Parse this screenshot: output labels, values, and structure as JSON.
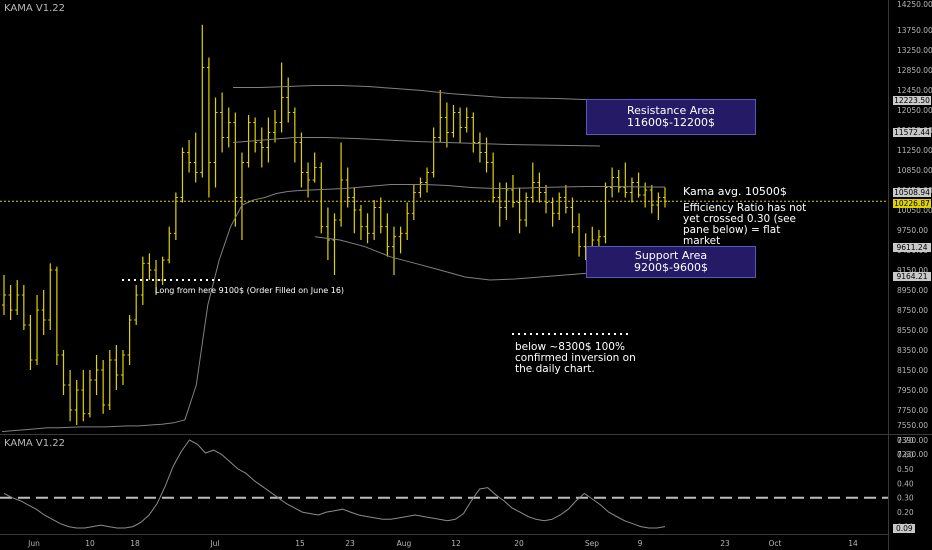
{
  "pane_titles": {
    "main": "KAMA V1.22",
    "lower": "KAMA V1.22"
  },
  "annotations": {
    "long": "Long from here 9100$ (Order Filled on June 16)",
    "kama_avg": "Kama avg. 10500$",
    "efficiency": [
      "Efficiency Ratio has not",
      "yet crossed 0.30 (see",
      "pane below) = flat",
      "market"
    ],
    "below": [
      "below ~8300$ 100%",
      "confirmed inversion on",
      "the daily chart."
    ]
  },
  "boxes": {
    "resistance": [
      "Resistance Area",
      "11600$-12200$"
    ],
    "support": [
      "Support Area",
      "9200$-9600$"
    ]
  },
  "price_labels": {
    "upper_band": "12223.50",
    "upper2": "11572.44",
    "kama": "10508.94",
    "current": "10226.87",
    "lower_band": "9611.24",
    "lower2": "9164.21"
  },
  "colors": {
    "background": "#000000",
    "bars": "#e0d200",
    "kama_line": "#808080",
    "annotation_box": "#241a66",
    "price_label": "#c9c9c9"
  },
  "chart_data": {
    "type": "ohlc",
    "instrument_indicator": "KAMA V1.22",
    "y_axis": {
      "ticks": [
        14250,
        13750,
        13250,
        12850,
        12450,
        12050,
        11650,
        11250,
        10850,
        10450,
        10050,
        9750,
        9450,
        9150,
        8950,
        8750,
        8550,
        8350,
        8150,
        7950,
        7750,
        7550,
        7390,
        7230
      ],
      "labels": [
        "14250.00",
        "13750.00",
        "13250.00",
        "12850.00",
        "12450.00",
        "12050.00",
        "11650.00",
        "11250.00",
        "10850.00",
        "10450.00",
        "10050.00",
        "9750.00",
        "9450.00",
        "9150.00",
        "8950.00",
        "8750.00",
        "8550.00",
        "8350.00",
        "8150.00",
        "7950.00",
        "7750.00",
        "7550.00",
        "7390.00",
        "7230.00"
      ]
    },
    "x_axis": {
      "labels": [
        "Jun",
        "10",
        "18",
        "Jul",
        "15",
        "23",
        "Aug",
        "12",
        "20",
        "Sep",
        "9",
        "23",
        "Oct",
        "14"
      ]
    },
    "lower_pane": {
      "ticks": [
        0.7,
        0.6,
        0.5,
        0.4,
        0.3,
        0.2,
        0.1
      ],
      "labels": [
        "0.70",
        "0.60",
        "0.50",
        "0.40",
        "0.30",
        "0.20",
        "0.10"
      ],
      "current": "0.09",
      "threshold": 0.3
    },
    "series": [
      {
        "name": "price_bars",
        "values": [
          {
            "o": 8800,
            "h": 9100,
            "l": 8700,
            "c": 8900
          },
          {
            "o": 8900,
            "h": 9000,
            "l": 8650,
            "c": 8750
          },
          {
            "o": 8750,
            "h": 9050,
            "l": 8700,
            "c": 8900
          },
          {
            "o": 8900,
            "h": 9000,
            "l": 8550,
            "c": 8600
          },
          {
            "o": 8600,
            "h": 8700,
            "l": 8150,
            "c": 8250
          },
          {
            "o": 8250,
            "h": 8900,
            "l": 8200,
            "c": 8750
          },
          {
            "o": 8750,
            "h": 8950,
            "l": 8500,
            "c": 8650
          },
          {
            "o": 8650,
            "h": 9250,
            "l": 8550,
            "c": 9150
          },
          {
            "o": 9150,
            "h": 9200,
            "l": 8200,
            "c": 8300
          },
          {
            "o": 8300,
            "h": 8350,
            "l": 7900,
            "c": 8000
          },
          {
            "o": 8000,
            "h": 8150,
            "l": 7600,
            "c": 7750
          },
          {
            "o": 7750,
            "h": 8050,
            "l": 7550,
            "c": 7950
          },
          {
            "o": 7950,
            "h": 8150,
            "l": 7600,
            "c": 7700
          },
          {
            "o": 7700,
            "h": 8150,
            "l": 7650,
            "c": 8050
          },
          {
            "o": 8050,
            "h": 8300,
            "l": 7900,
            "c": 8150
          },
          {
            "o": 8150,
            "h": 8250,
            "l": 7700,
            "c": 7800
          },
          {
            "o": 7800,
            "h": 8350,
            "l": 7750,
            "c": 8250
          },
          {
            "o": 8250,
            "h": 8400,
            "l": 7950,
            "c": 8100
          },
          {
            "o": 8100,
            "h": 8350,
            "l": 8000,
            "c": 8300
          },
          {
            "o": 8300,
            "h": 8700,
            "l": 8200,
            "c": 8650
          },
          {
            "o": 8650,
            "h": 9000,
            "l": 8600,
            "c": 8900
          },
          {
            "o": 8900,
            "h": 9350,
            "l": 8800,
            "c": 9250
          },
          {
            "o": 9250,
            "h": 9400,
            "l": 9050,
            "c": 9150
          },
          {
            "o": 9150,
            "h": 9300,
            "l": 8900,
            "c": 9050
          },
          {
            "o": 9050,
            "h": 9350,
            "l": 9000,
            "c": 9300
          },
          {
            "o": 9300,
            "h": 9800,
            "l": 9250,
            "c": 9700
          },
          {
            "o": 9700,
            "h": 10400,
            "l": 9600,
            "c": 10300
          },
          {
            "o": 10300,
            "h": 11300,
            "l": 10200,
            "c": 11200
          },
          {
            "o": 11200,
            "h": 11450,
            "l": 10800,
            "c": 11000
          },
          {
            "o": 11000,
            "h": 11600,
            "l": 10600,
            "c": 10800
          },
          {
            "o": 10800,
            "h": 13850,
            "l": 10700,
            "c": 12900
          },
          {
            "o": 12900,
            "h": 13100,
            "l": 10300,
            "c": 11000
          },
          {
            "o": 11000,
            "h": 12300,
            "l": 10500,
            "c": 12000
          },
          {
            "o": 12000,
            "h": 12400,
            "l": 11200,
            "c": 11500
          },
          {
            "o": 11500,
            "h": 12100,
            "l": 11300,
            "c": 11800
          },
          {
            "o": 11800,
            "h": 12000,
            "l": 9800,
            "c": 10300
          },
          {
            "o": 10300,
            "h": 11200,
            "l": 9600,
            "c": 11000
          },
          {
            "o": 11000,
            "h": 11950,
            "l": 10900,
            "c": 11800
          },
          {
            "o": 11800,
            "h": 11900,
            "l": 11200,
            "c": 11400
          },
          {
            "o": 11400,
            "h": 11700,
            "l": 10900,
            "c": 11300
          },
          {
            "o": 11300,
            "h": 11900,
            "l": 11000,
            "c": 11600
          },
          {
            "o": 11600,
            "h": 12050,
            "l": 11400,
            "c": 11800
          },
          {
            "o": 11800,
            "h": 13000,
            "l": 11600,
            "c": 12300
          },
          {
            "o": 12300,
            "h": 12700,
            "l": 11800,
            "c": 12000
          },
          {
            "o": 12000,
            "h": 12100,
            "l": 11000,
            "c": 11400
          },
          {
            "o": 11400,
            "h": 11600,
            "l": 10500,
            "c": 10800
          },
          {
            "o": 10800,
            "h": 11000,
            "l": 10300,
            "c": 10650
          },
          {
            "o": 10650,
            "h": 11200,
            "l": 10600,
            "c": 10900
          },
          {
            "o": 10900,
            "h": 11000,
            "l": 9700,
            "c": 9800
          },
          {
            "o": 9800,
            "h": 10100,
            "l": 9300,
            "c": 9600
          },
          {
            "o": 9600,
            "h": 10000,
            "l": 9100,
            "c": 9900
          },
          {
            "o": 9900,
            "h": 11400,
            "l": 9800,
            "c": 10650
          },
          {
            "o": 10650,
            "h": 10900,
            "l": 10100,
            "c": 10300
          },
          {
            "o": 10300,
            "h": 10500,
            "l": 9700,
            "c": 10050
          },
          {
            "o": 10050,
            "h": 10150,
            "l": 9600,
            "c": 9800
          },
          {
            "o": 9800,
            "h": 10000,
            "l": 9550,
            "c": 9700
          },
          {
            "o": 9700,
            "h": 10250,
            "l": 9600,
            "c": 10100
          },
          {
            "o": 10100,
            "h": 10300,
            "l": 9700,
            "c": 9800
          },
          {
            "o": 9800,
            "h": 10000,
            "l": 9350,
            "c": 9500
          },
          {
            "o": 9500,
            "h": 9800,
            "l": 9100,
            "c": 9650
          },
          {
            "o": 9650,
            "h": 9800,
            "l": 9400,
            "c": 9700
          },
          {
            "o": 9700,
            "h": 10200,
            "l": 9600,
            "c": 10000
          },
          {
            "o": 10000,
            "h": 10550,
            "l": 9900,
            "c": 10400
          },
          {
            "o": 10400,
            "h": 10700,
            "l": 10300,
            "c": 10600
          },
          {
            "o": 10600,
            "h": 10900,
            "l": 10400,
            "c": 10800
          },
          {
            "o": 10800,
            "h": 11700,
            "l": 10700,
            "c": 11500
          },
          {
            "o": 11500,
            "h": 12450,
            "l": 11400,
            "c": 11900
          },
          {
            "o": 11900,
            "h": 12200,
            "l": 11300,
            "c": 11600
          },
          {
            "o": 11600,
            "h": 12150,
            "l": 11500,
            "c": 12000
          },
          {
            "o": 12000,
            "h": 12100,
            "l": 11400,
            "c": 11700
          },
          {
            "o": 11700,
            "h": 12100,
            "l": 11600,
            "c": 11900
          },
          {
            "o": 11900,
            "h": 12000,
            "l": 11200,
            "c": 11400
          },
          {
            "o": 11400,
            "h": 11600,
            "l": 11000,
            "c": 11200
          },
          {
            "o": 11200,
            "h": 11500,
            "l": 10800,
            "c": 11000
          },
          {
            "o": 11000,
            "h": 11200,
            "l": 10200,
            "c": 10300
          },
          {
            "o": 10300,
            "h": 10600,
            "l": 9800,
            "c": 10100
          },
          {
            "o": 10100,
            "h": 10600,
            "l": 9900,
            "c": 10450
          },
          {
            "o": 10450,
            "h": 10750,
            "l": 10100,
            "c": 10200
          },
          {
            "o": 10200,
            "h": 10500,
            "l": 9700,
            "c": 9900
          },
          {
            "o": 9900,
            "h": 10400,
            "l": 9800,
            "c": 10300
          },
          {
            "o": 10300,
            "h": 11000,
            "l": 10200,
            "c": 10600
          },
          {
            "o": 10600,
            "h": 10800,
            "l": 10200,
            "c": 10400
          },
          {
            "o": 10400,
            "h": 10550,
            "l": 10000,
            "c": 10200
          },
          {
            "o": 10200,
            "h": 10300,
            "l": 9800,
            "c": 10000
          },
          {
            "o": 10000,
            "h": 10400,
            "l": 9900,
            "c": 10300
          },
          {
            "o": 10300,
            "h": 10550,
            "l": 10000,
            "c": 10100
          },
          {
            "o": 10100,
            "h": 10300,
            "l": 9700,
            "c": 9800
          },
          {
            "o": 9800,
            "h": 10000,
            "l": 9350,
            "c": 9500
          },
          {
            "o": 9500,
            "h": 9700,
            "l": 9300,
            "c": 9400
          },
          {
            "o": 9400,
            "h": 9800,
            "l": 9300,
            "c": 9600
          },
          {
            "o": 9600,
            "h": 9750,
            "l": 9500,
            "c": 9650
          },
          {
            "o": 9650,
            "h": 10600,
            "l": 9550,
            "c": 10500
          },
          {
            "o": 10500,
            "h": 10900,
            "l": 10300,
            "c": 10700
          },
          {
            "o": 10700,
            "h": 10850,
            "l": 10400,
            "c": 10500
          },
          {
            "o": 10500,
            "h": 11000,
            "l": 10300,
            "c": 10400
          },
          {
            "o": 10400,
            "h": 10700,
            "l": 10200,
            "c": 10600
          },
          {
            "o": 10600,
            "h": 10800,
            "l": 10300,
            "c": 10350
          },
          {
            "o": 10350,
            "h": 10600,
            "l": 10100,
            "c": 10450
          },
          {
            "o": 10450,
            "h": 10550,
            "l": 10000,
            "c": 10150
          },
          {
            "o": 10150,
            "h": 10400,
            "l": 9900,
            "c": 10300
          },
          {
            "o": 10300,
            "h": 10500,
            "l": 10100,
            "c": 10226
          }
        ]
      },
      {
        "name": "kama",
        "values": [
          7480,
          7490,
          7500,
          7510,
          7520,
          7520,
          7525,
          7530,
          7530,
          7530,
          7535,
          7540,
          7540,
          7550,
          7560,
          7580,
          7620,
          8000,
          8800,
          9300,
          9800,
          10150,
          10250,
          10300,
          10380,
          10420,
          10440,
          10450,
          10460,
          10470,
          10480,
          10500,
          10520,
          10540,
          10560,
          10560,
          10560,
          10560,
          10550,
          10540,
          10520,
          10500,
          10490,
          10480,
          10480,
          10485,
          10490,
          10500,
          10505,
          10510,
          10515,
          10520,
          10520,
          10520,
          10518,
          10515,
          10512,
          10510,
          10508
        ],
        "x_span": [
          0,
          1
        ]
      },
      {
        "name": "upper_band",
        "values": [
          12500,
          12500,
          12520,
          12540,
          12540,
          12520,
          12480,
          12440,
          12380,
          12340,
          12300,
          12290,
          12280,
          12260,
          12240,
          12230,
          12224
        ]
      },
      {
        "name": "lower_band",
        "values": [
          9650,
          9600,
          9500,
          9350,
          9250,
          9150,
          9080,
          9050,
          9060,
          9080,
          9100,
          9120,
          9140,
          9160,
          9165
        ]
      },
      {
        "name": "efficiency_ratio",
        "values": [
          0.33,
          0.3,
          0.28,
          0.25,
          0.22,
          0.18,
          0.15,
          0.12,
          0.1,
          0.09,
          0.09,
          0.1,
          0.11,
          0.1,
          0.09,
          0.09,
          0.1,
          0.13,
          0.18,
          0.26,
          0.38,
          0.52,
          0.62,
          0.7,
          0.67,
          0.61,
          0.63,
          0.6,
          0.55,
          0.5,
          0.47,
          0.42,
          0.38,
          0.34,
          0.3,
          0.26,
          0.23,
          0.2,
          0.19,
          0.18,
          0.2,
          0.21,
          0.22,
          0.2,
          0.18,
          0.17,
          0.16,
          0.15,
          0.15,
          0.16,
          0.17,
          0.18,
          0.17,
          0.16,
          0.15,
          0.14,
          0.15,
          0.19,
          0.28,
          0.36,
          0.37,
          0.32,
          0.28,
          0.23,
          0.2,
          0.17,
          0.15,
          0.14,
          0.15,
          0.18,
          0.22,
          0.28,
          0.33,
          0.29,
          0.25,
          0.2,
          0.17,
          0.14,
          0.12,
          0.1,
          0.09,
          0.09,
          0.1
        ]
      }
    ]
  }
}
